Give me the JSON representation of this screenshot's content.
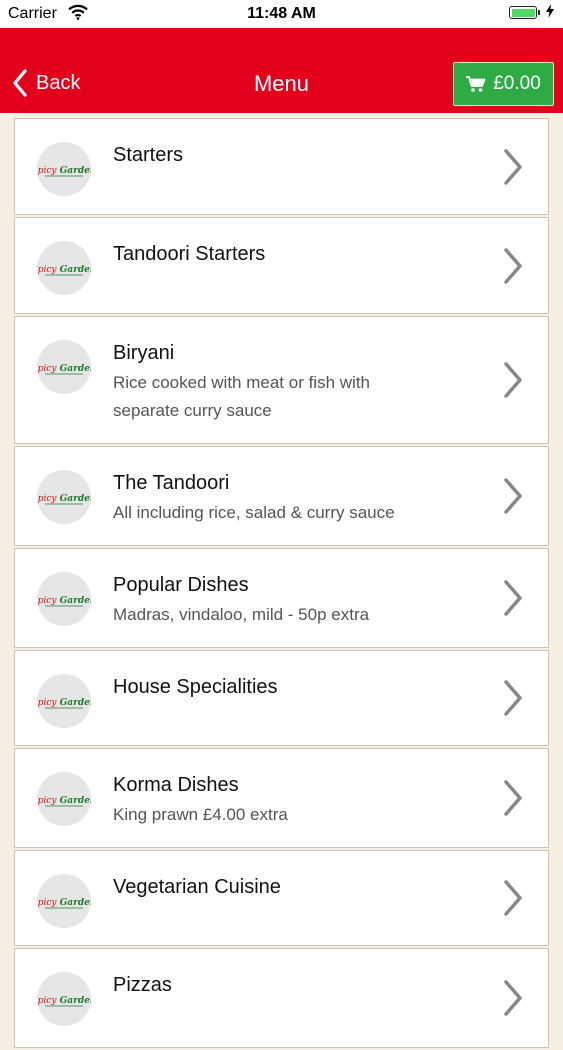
{
  "status_bar": {
    "carrier": "Carrier",
    "time": "11:48 AM"
  },
  "nav": {
    "back_label": "Back",
    "title": "Menu",
    "cart_total": "£0.00"
  },
  "colors": {
    "nav_bg": "#e3001b",
    "cart_bg": "#2eab45",
    "page_bg": "#f5f0e1"
  },
  "menu": {
    "items": [
      {
        "title": "Starters",
        "desc": ""
      },
      {
        "title": "Tandoori Starters",
        "desc": ""
      },
      {
        "title": "Biryani",
        "desc": "Rice cooked with meat or fish with separate curry sauce"
      },
      {
        "title": "The Tandoori",
        "desc": "All including rice, salad & curry sauce"
      },
      {
        "title": "Popular Dishes",
        "desc": "Madras, vindaloo, mild - 50p extra"
      },
      {
        "title": "House Specialities",
        "desc": ""
      },
      {
        "title": "Korma Dishes",
        "desc": "King prawn £4.00 extra"
      },
      {
        "title": "Vegetarian Cuisine",
        "desc": ""
      },
      {
        "title": "Pizzas",
        "desc": ""
      }
    ]
  },
  "logo_text": "Spicy Garden",
  "icons": [
    "wifi-icon",
    "battery-icon",
    "back-chevron-icon",
    "cart-icon",
    "chevron-right-icon",
    "restaurant-logo"
  ]
}
